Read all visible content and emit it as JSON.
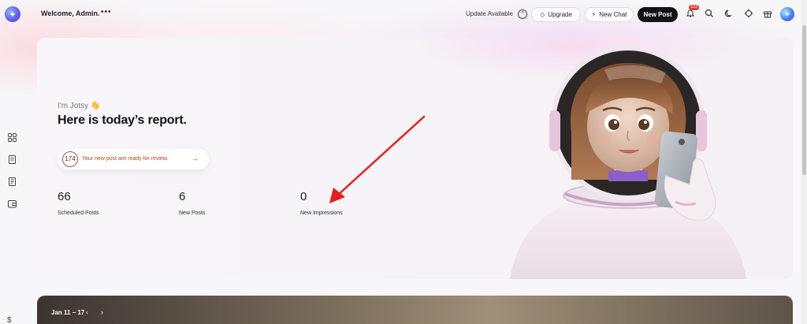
{
  "header": {
    "welcome": "Welcome, Admin.",
    "more": "•••",
    "update_available": "Update Available",
    "upgrade": "Upgrade",
    "new_chat": "New Chat",
    "new_post": "New Post",
    "notification_count": "122",
    "icons": [
      "logo-icon",
      "info-icon",
      "bell-icon",
      "search-icon",
      "moon-icon",
      "crosshair-icon",
      "gift-icon",
      "assistant-avatar"
    ]
  },
  "sidebar": {
    "icons": [
      "grid-icon",
      "book-icon",
      "document-icon",
      "wallet-icon",
      "dollar-icon"
    ]
  },
  "report": {
    "intro": "I'm Jotsy 👋",
    "headline": "Here is today’s report.",
    "review_count": "174",
    "review_text": "Your new post are ready for review.",
    "stats": [
      {
        "value": "66",
        "label": "Scheduled Posts"
      },
      {
        "value": "6",
        "label": "New Posts"
      },
      {
        "value": "0",
        "label": "New Impressions"
      }
    ]
  },
  "banner": {
    "date_range": "Jan 11 – 17",
    "prev": "‹",
    "next": "›"
  },
  "colors": {
    "annotation_arrow": "#e3201b",
    "accent": "#b5441c",
    "dark": "#121217"
  }
}
